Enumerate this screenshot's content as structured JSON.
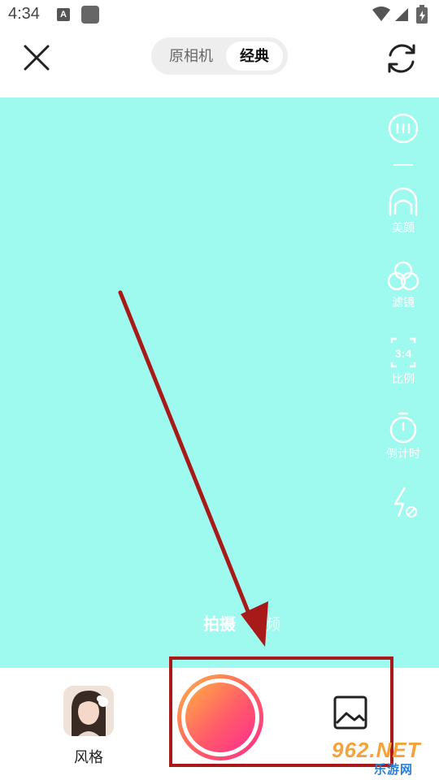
{
  "status_bar": {
    "time": "4:34",
    "notification_glyph": "A"
  },
  "top_bar": {
    "mode_options": [
      "原相机",
      "经典"
    ],
    "selected_mode": "经典"
  },
  "side_rail": {
    "items": [
      {
        "icon": "more-icon",
        "label": ""
      },
      {
        "icon": "beauty-icon",
        "label": "美颜"
      },
      {
        "icon": "filter-icon",
        "label": "滤镜"
      },
      {
        "icon": "ratio-icon",
        "label": "比例",
        "icon_text": "3:4"
      },
      {
        "icon": "timer-icon",
        "label": "倒计时"
      },
      {
        "icon": "flash-off-icon",
        "label": ""
      }
    ]
  },
  "capture_tabs": {
    "photo": "拍摄",
    "video": "视频",
    "active": "拍摄"
  },
  "bottom_bar": {
    "style_label": "风格"
  },
  "watermark": {
    "brand": "962.NET",
    "sub": "乐游网"
  },
  "colors": {
    "viewfinder_bg": "#9efaee",
    "shutter_gradient_start": "#ffb347",
    "shutter_gradient_end": "#ff2d8a",
    "annotation_red": "#a8191a"
  }
}
